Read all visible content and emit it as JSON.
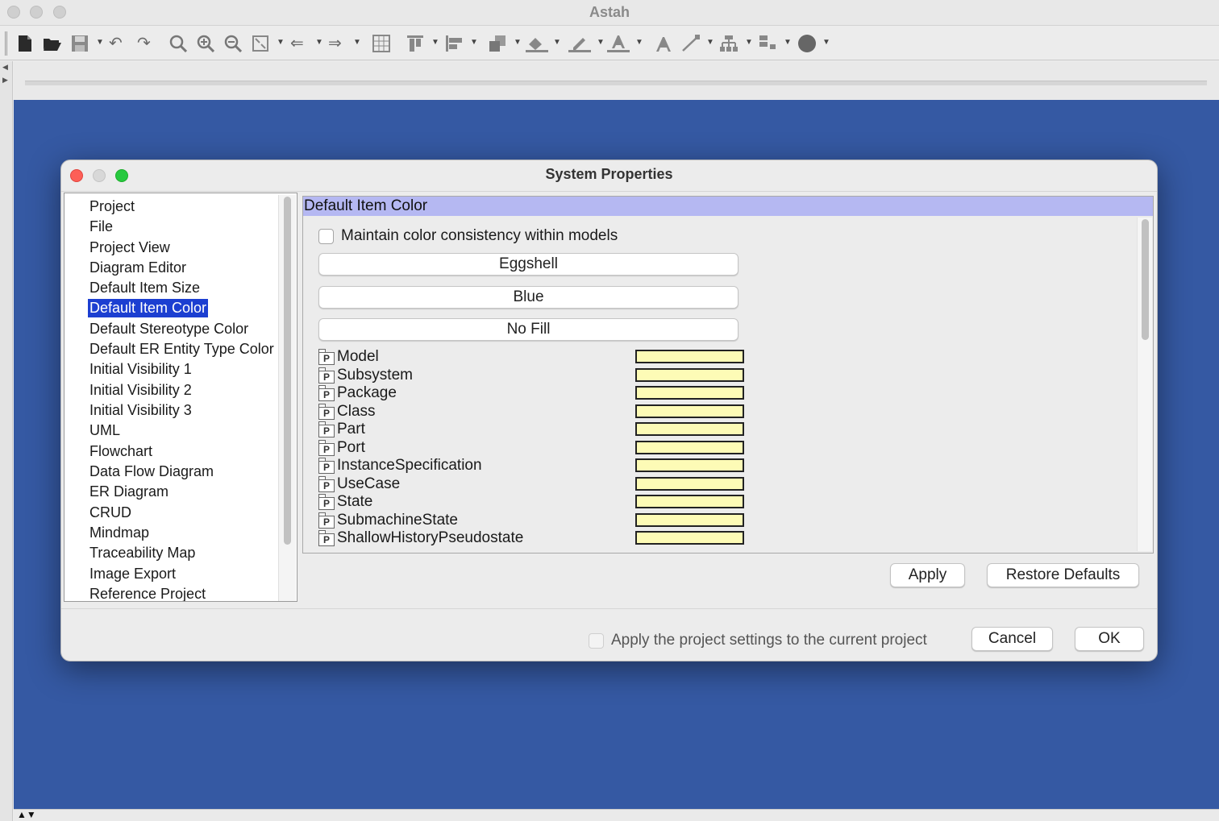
{
  "window": {
    "title": "Astah"
  },
  "toolbar": {
    "icons": [
      "new-file-icon",
      "open-folder-icon",
      "save-icon",
      "undo-icon",
      "redo-icon",
      "zoom-fit-icon",
      "zoom-in-icon",
      "zoom-out-icon",
      "fit-window-icon",
      "back-icon",
      "forward-icon",
      "grid-icon",
      "align-top-icon",
      "align-left-icon",
      "arrange-icon",
      "fill-color-icon",
      "line-color-icon",
      "font-color-icon",
      "font-icon",
      "line-style-icon",
      "tree-layout-icon",
      "layout-icon",
      "color-circle-icon"
    ]
  },
  "dialog": {
    "title": "System Properties",
    "nav": {
      "items": [
        "Project",
        "File",
        "Project View",
        "Diagram Editor",
        "Default Item Size",
        "Default Item Color",
        "Default Stereotype Color",
        "Default ER Entity Type Color",
        "Initial Visibility 1",
        "Initial Visibility 2",
        "Initial Visibility 3",
        "UML",
        "Flowchart",
        "Data Flow Diagram",
        "ER Diagram",
        "CRUD",
        "Mindmap",
        "Traceability Map",
        "Image Export",
        "Reference Project"
      ],
      "selected": "Default Item Color"
    },
    "panel": {
      "header": "Default Item Color",
      "checkbox_label": "Maintain color consistency within models",
      "checkbox_checked": false,
      "preset_buttons": [
        "Eggshell",
        "Blue",
        "No Fill"
      ],
      "items": [
        {
          "icon_letter": "P",
          "name": "Model",
          "color": "#fdfbb6"
        },
        {
          "icon_letter": "P",
          "name": "Subsystem",
          "color": "#fdfbb6"
        },
        {
          "icon_letter": "P",
          "name": "Package",
          "color": "#fdfbb6"
        },
        {
          "icon_letter": "P",
          "name": "Class",
          "color": "#fdfbb6"
        },
        {
          "icon_letter": "P",
          "name": "Part",
          "color": "#fdfbb6"
        },
        {
          "icon_letter": "P",
          "name": "Port",
          "color": "#fdfbb6"
        },
        {
          "icon_letter": "P",
          "name": "InstanceSpecification",
          "color": "#fdfbb6"
        },
        {
          "icon_letter": "P",
          "name": "UseCase",
          "color": "#fdfbb6"
        },
        {
          "icon_letter": "P",
          "name": "State",
          "color": "#fdfbb6"
        },
        {
          "icon_letter": "P",
          "name": "SubmachineState",
          "color": "#fdfbb6"
        },
        {
          "icon_letter": "P",
          "name": "ShallowHistoryPseudostate",
          "color": "#fdfbb6"
        }
      ]
    },
    "apply_label": "Apply",
    "restore_label": "Restore Defaults",
    "footer": {
      "apply_project_label": "Apply the project settings to the current project",
      "cancel_label": "Cancel",
      "ok_label": "OK"
    }
  },
  "colors": {
    "canvas": "#3559a3",
    "selection": "#1c3fd1",
    "panel_header": "#b5b8f2",
    "swatch": "#fdfbb6"
  }
}
